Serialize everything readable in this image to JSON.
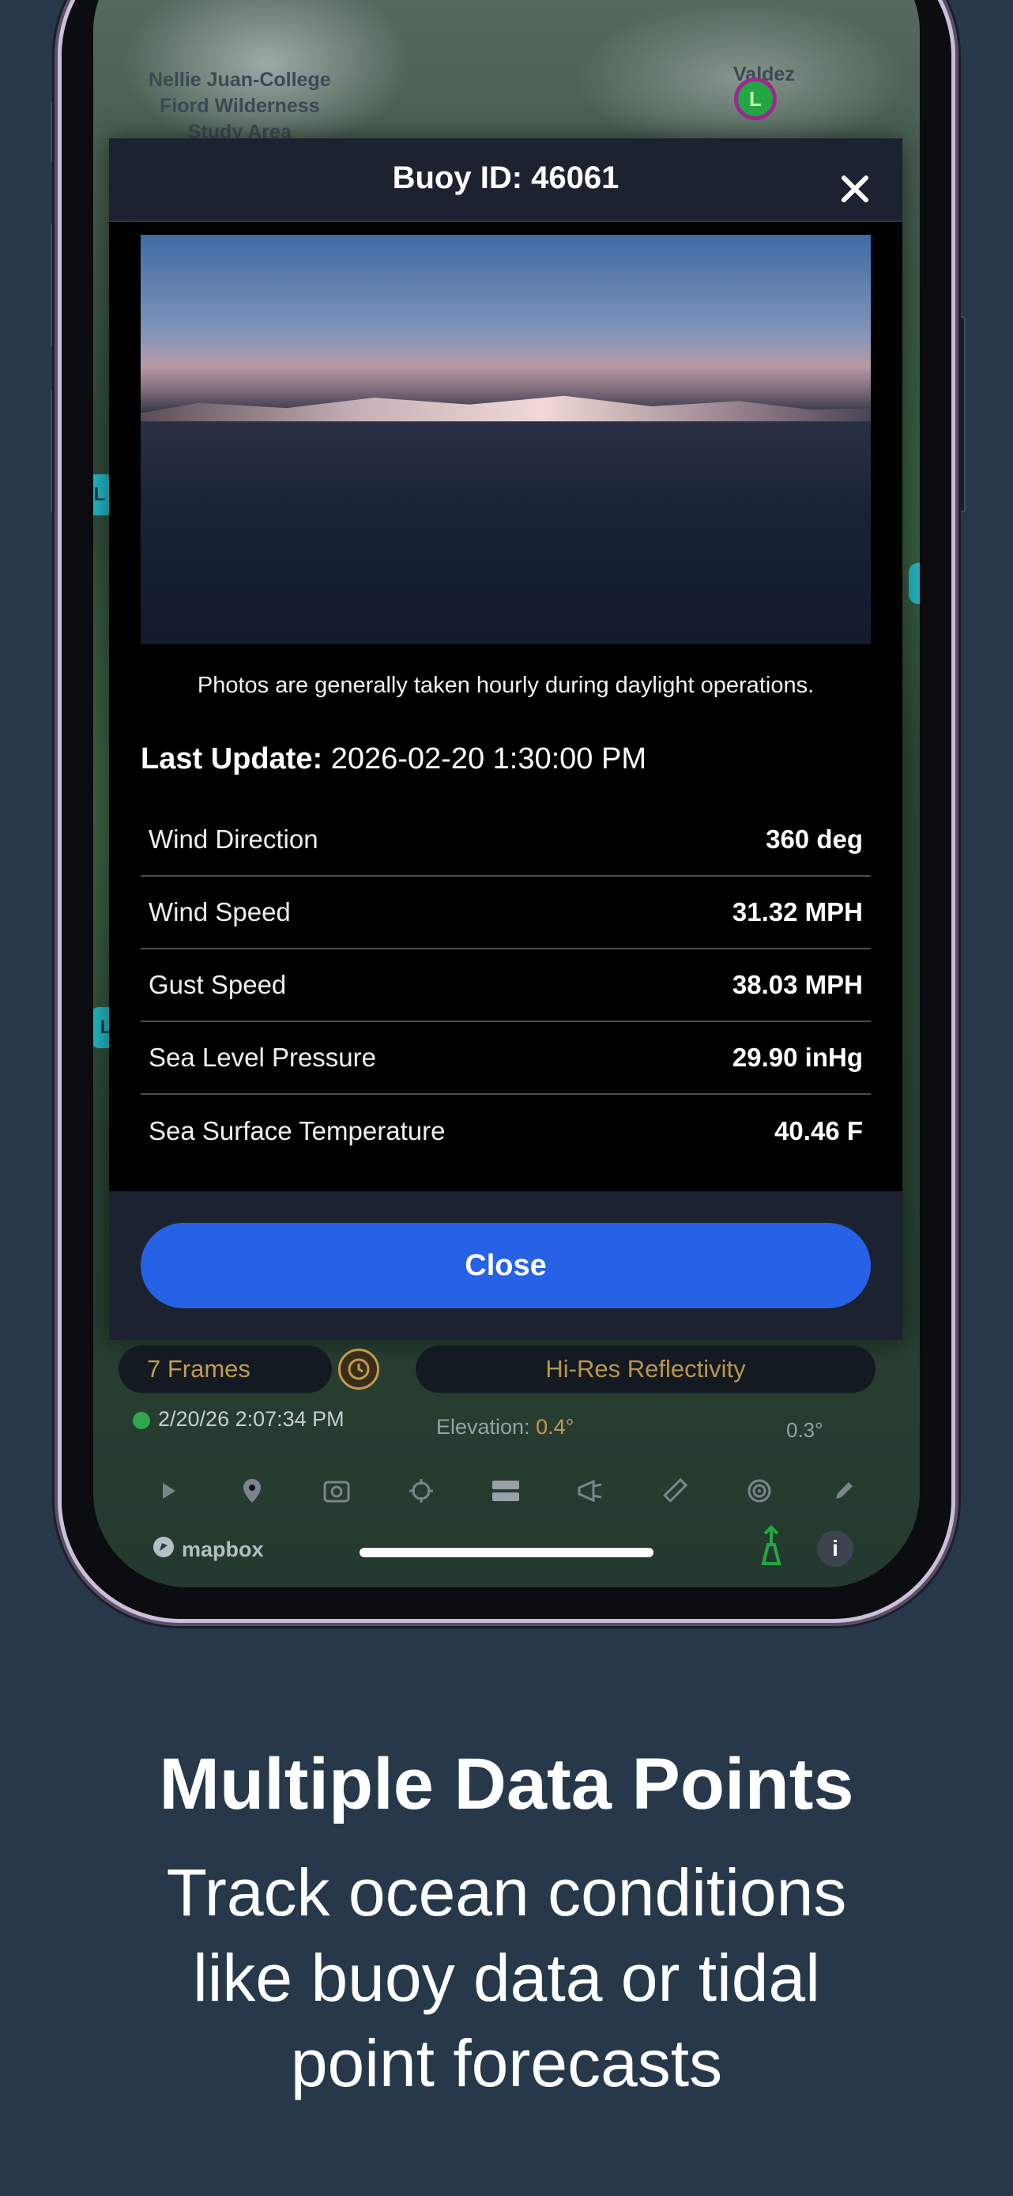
{
  "map": {
    "area_label": "Nellie Juan-College\nFiord Wilderness\nStudy Area",
    "city_label": "Valdez"
  },
  "modal": {
    "title": "Buoy ID: 46061",
    "close_icon": "close-icon",
    "photo_note": "Photos are generally taken hourly during daylight operations.",
    "last_update_label": "Last Update:",
    "last_update_value": "2026-02-20 1:30:00 PM",
    "rows": [
      {
        "label": "Wind Direction",
        "value": "360 deg"
      },
      {
        "label": "Wind Speed",
        "value": "31.32 MPH"
      },
      {
        "label": "Gust Speed",
        "value": "38.03 MPH"
      },
      {
        "label": "Sea Level Pressure",
        "value": "29.90 inHg"
      },
      {
        "label": "Sea Surface Temperature",
        "value": "40.46 F"
      }
    ],
    "close_button": "Close"
  },
  "toolbar": {
    "frames": "7 Frames",
    "product": "Hi-Res Reflectivity",
    "timestamp": "2/20/26 2:07:34 PM",
    "elevation_label": "Elevation:",
    "elevation_value": "0.4°",
    "angle": "0.3°",
    "tools": [
      "play-icon",
      "location-pin-icon",
      "screenshot-icon",
      "crosshair-icon",
      "layers-icon",
      "megaphone-icon",
      "ruler-icon",
      "radar-icon",
      "pencil-icon"
    ],
    "mapbox": "mapbox",
    "info": "i"
  },
  "marketing": {
    "headline": "Multiple Data Points",
    "subtext_line1": "Track ocean conditions",
    "subtext_line2": "like buoy data or tidal",
    "subtext_line3": "point forecasts"
  },
  "colors": {
    "background": "#27384a",
    "accent": "#2761e6",
    "toolbar_amber": "#c49a4e"
  }
}
